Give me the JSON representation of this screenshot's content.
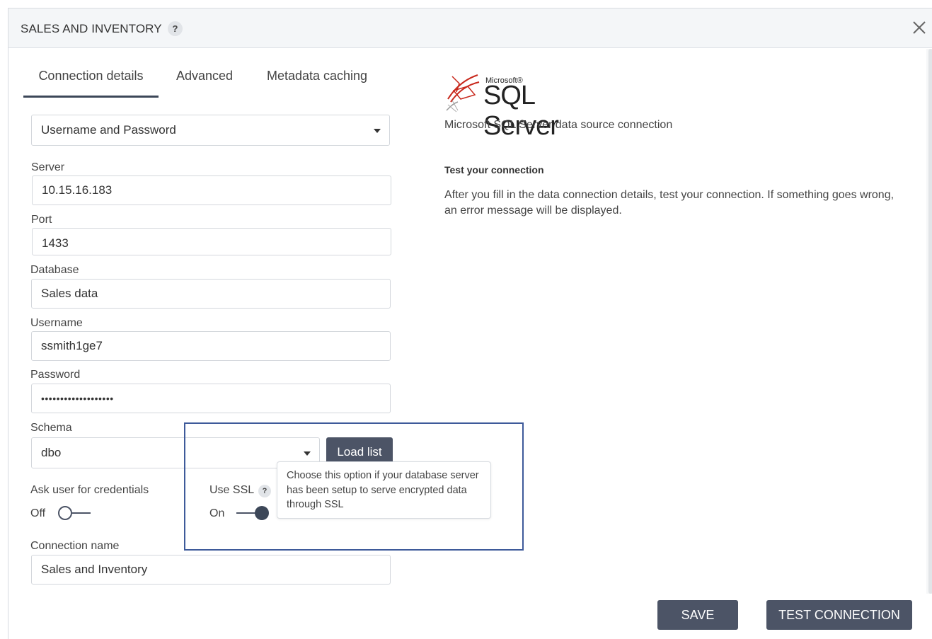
{
  "dialog": {
    "title": "SALES AND INVENTORY",
    "help_glyph": "?",
    "close_icon": "close-icon"
  },
  "tabs": [
    {
      "label": "Connection details",
      "active": true
    },
    {
      "label": "Advanced",
      "active": false
    },
    {
      "label": "Metadata caching",
      "active": false
    }
  ],
  "form": {
    "auth_method": "Username and Password",
    "server": {
      "label": "Server",
      "value": "10.15.16.183"
    },
    "port": {
      "label": "Port",
      "value": "1433"
    },
    "database": {
      "label": "Database",
      "value": "Sales data"
    },
    "username": {
      "label": "Username",
      "value": "ssmith1ge7"
    },
    "password": {
      "label": "Password",
      "value": "•••••••••••••••••••"
    },
    "schema": {
      "label": "Schema",
      "value": "dbo",
      "load_button": "Load list"
    },
    "ask_credentials": {
      "label": "Ask user for credentials",
      "state_text": "Off",
      "on": false
    },
    "use_ssl": {
      "label": "Use SSL",
      "help_glyph": "?",
      "state_text": "On",
      "on": true
    },
    "connection_name": {
      "label": "Connection name",
      "value": "Sales and Inventory"
    }
  },
  "tooltip": {
    "text": "Choose this option if your database server has been setup to serve encrypted data through SSL"
  },
  "info_panel": {
    "logo_small": "Microsoft®",
    "logo_big": "SQL Server",
    "description": "Microsoft SQL Server data source connection",
    "heading": "Test your connection",
    "body": "After you fill in the data connection details, test your connection. If something goes wrong, an error message will be displayed."
  },
  "footer": {
    "save_label": "SAVE",
    "test_label": "TEST CONNECTION"
  },
  "colors": {
    "button_bg": "#4c5466",
    "header_bg": "#f4f6f8",
    "highlight_border": "#3e5a9a",
    "logo_red": "#c8281c"
  }
}
